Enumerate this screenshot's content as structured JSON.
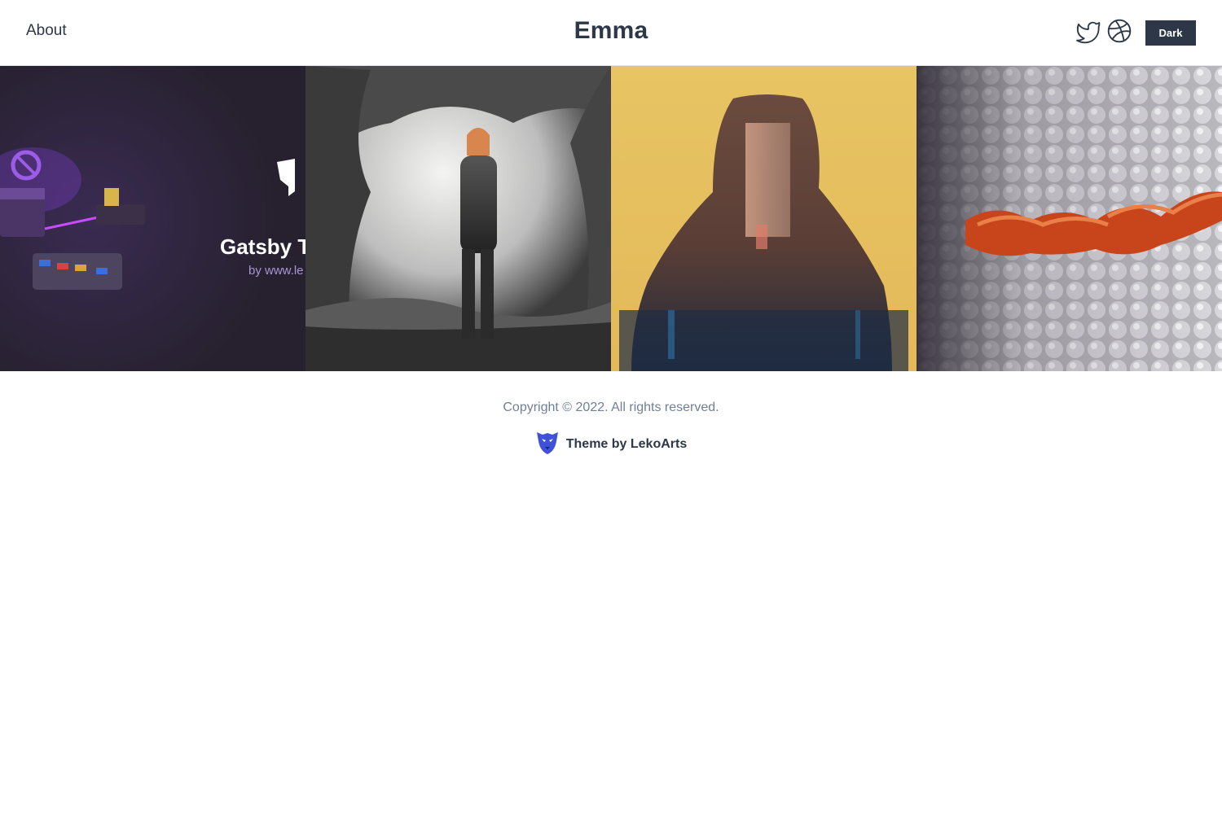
{
  "header": {
    "nav_about": "About",
    "site_title": "Emma",
    "social": [
      {
        "icon": "twitter-icon"
      },
      {
        "icon": "dribbble-icon"
      }
    ],
    "color_mode_label": "Dark"
  },
  "projects": [
    {
      "title_fragment": "Gatsby T",
      "subtitle_fragment": "by www.le",
      "dominant_color": "#27212f"
    },
    {
      "dominant_color": "#8a8a8a"
    },
    {
      "dominant_color": "#e8c463"
    },
    {
      "dominant_color": "#c9c9cc"
    }
  ],
  "footer": {
    "copyright": "Copyright © 2022. All rights reserved.",
    "credit": "Theme by LekoArts",
    "credit_icon": "lekoarts-logo-icon"
  },
  "colors": {
    "text": "#2d3748",
    "muted": "#718096",
    "button_bg": "#2d3748",
    "logo_blue": "#3f51d6"
  }
}
